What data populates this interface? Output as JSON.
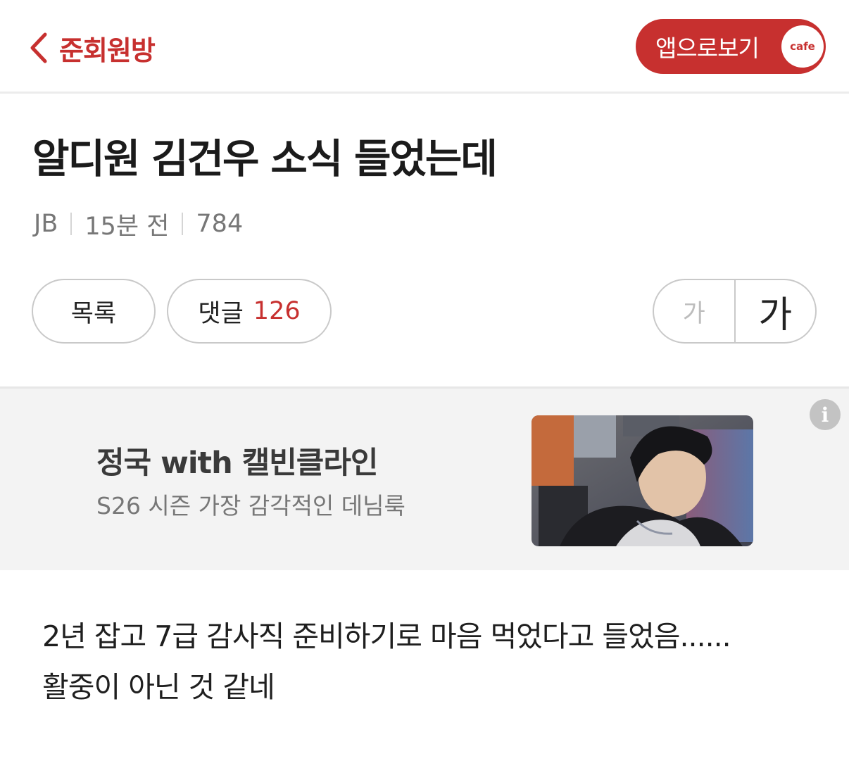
{
  "header": {
    "back_icon": "chevron-left-icon",
    "cafe_name": "준회원방",
    "app_button_label": "앱으로보기",
    "app_badge_text": "cafe",
    "accent_color": "#c7302f"
  },
  "post": {
    "title": "알디원 김건우 소식 들었는데",
    "author": "JB",
    "time": "15분 전",
    "views": "784",
    "body_lines": [
      "2년 잡고 7급 감사직 준비하기로 마음 먹었다고 들었음......",
      "활중이 아닌 것 같네"
    ]
  },
  "actions": {
    "list_label": "목록",
    "comments_label": "댓글",
    "comments_count": "126",
    "font_small_label": "가",
    "font_large_label": "가"
  },
  "ad": {
    "title": "정국 with 캘빈클라인",
    "subtitle": "S26 시즌 가장 감각적인 데님룩",
    "info_icon": "info-icon",
    "info_glyph": "i"
  }
}
